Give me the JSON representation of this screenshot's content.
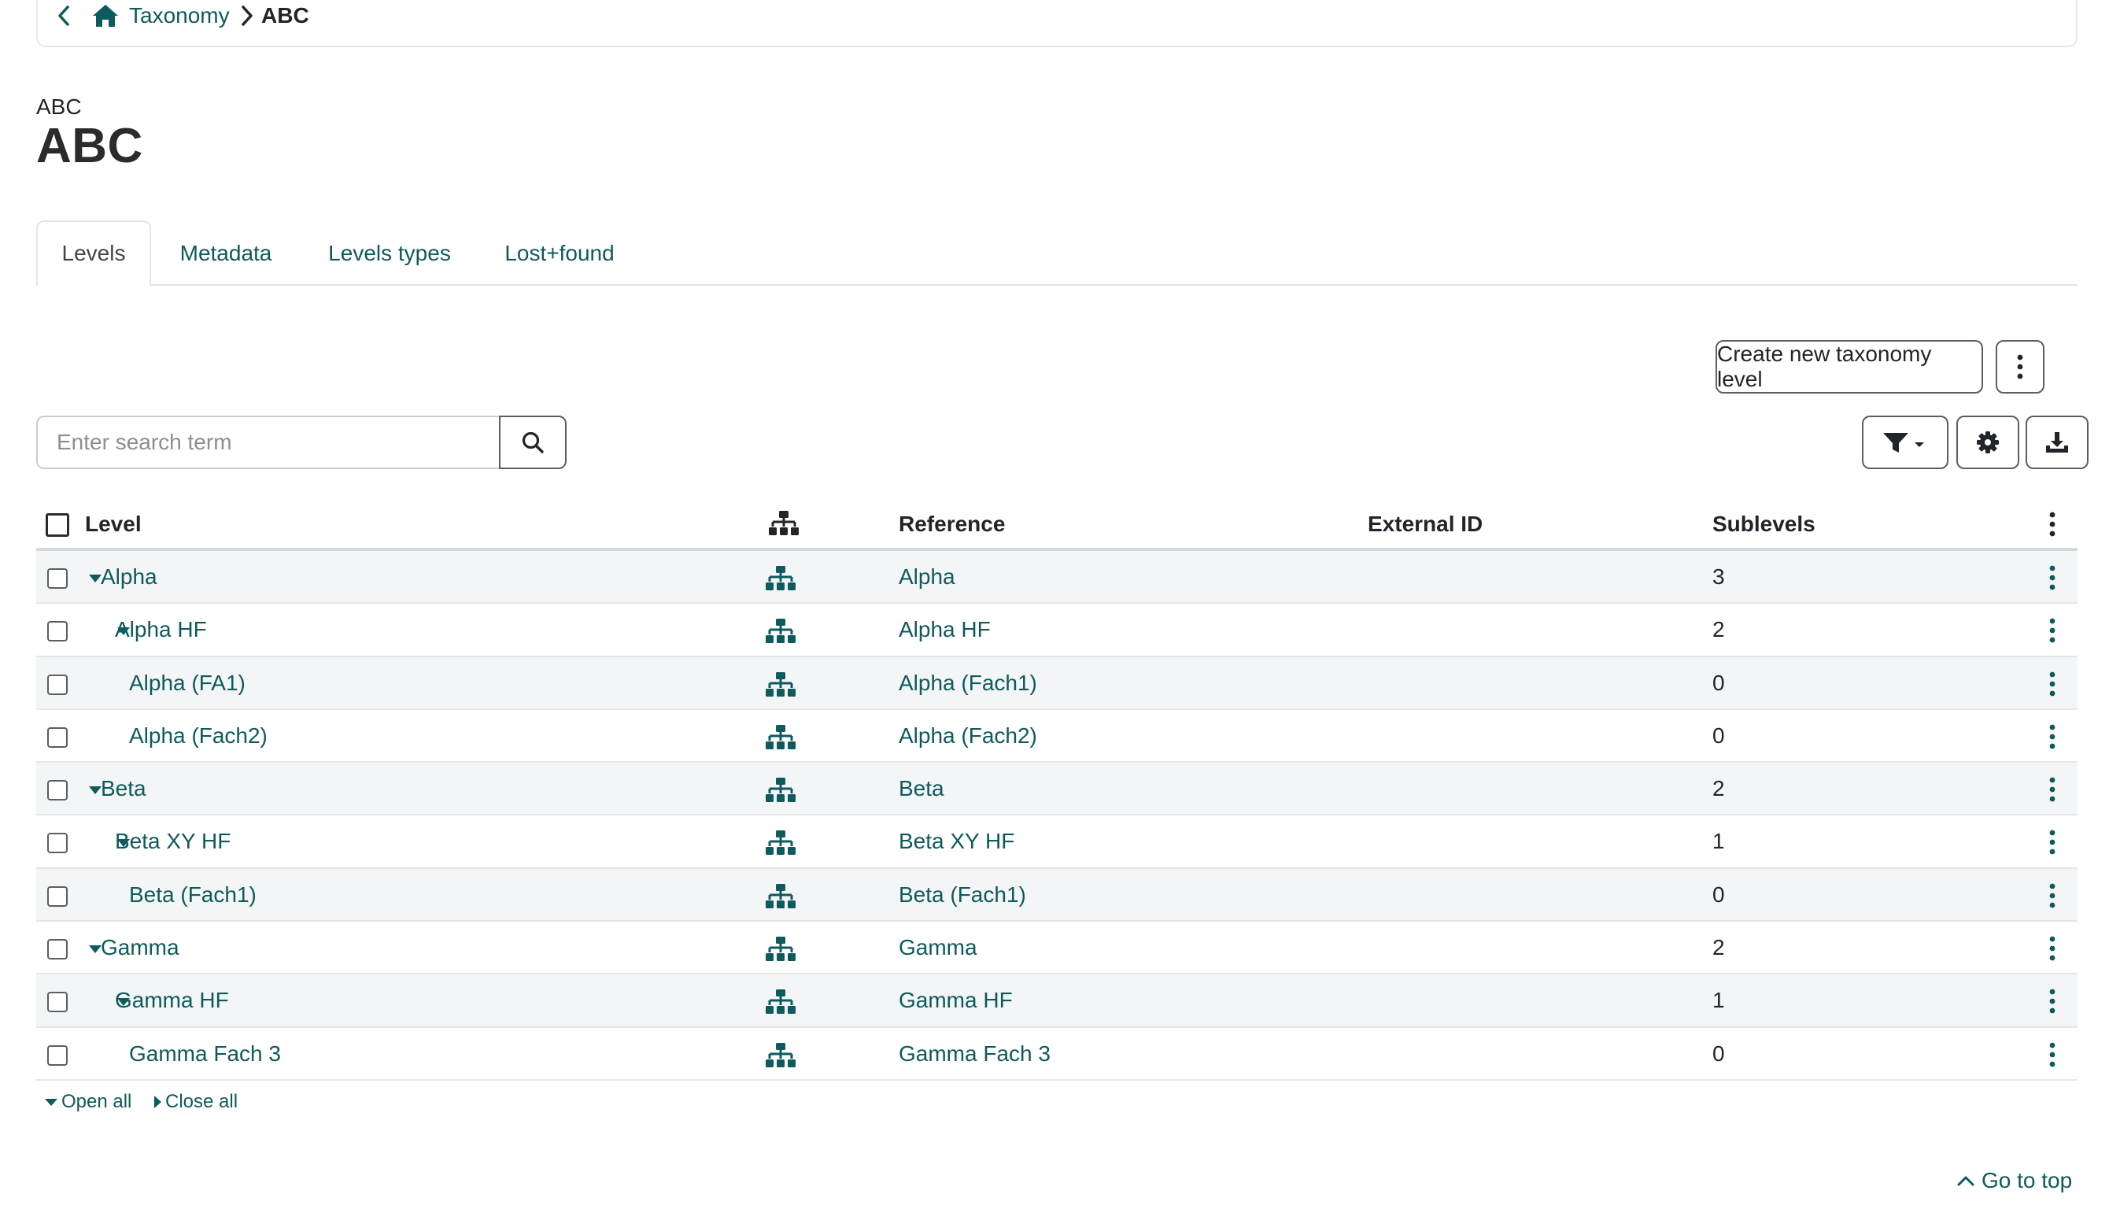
{
  "breadcrumb": {
    "back_icon": "chevron-left-icon",
    "home_icon": "home-icon",
    "parent": "Taxonomy",
    "separator_icon": "chevron-right-icon",
    "current": "ABC"
  },
  "header": {
    "subtitle": "ABC",
    "title": "ABC"
  },
  "tabs": [
    {
      "label": "Levels",
      "active": true
    },
    {
      "label": "Metadata",
      "active": false
    },
    {
      "label": "Levels types",
      "active": false
    },
    {
      "label": "Lost+found",
      "active": false
    }
  ],
  "toolbar": {
    "create_label": "Create new taxonomy level",
    "more_icon": "kebab-vertical-icon",
    "filter_icon": "filter-icon",
    "settings_icon": "gear-icon",
    "download_icon": "download-icon"
  },
  "search": {
    "placeholder": "Enter search term",
    "value": "",
    "button_icon": "search-icon"
  },
  "table": {
    "columns": {
      "level": "Level",
      "structure_icon": "hierarchy-icon",
      "reference": "Reference",
      "external_id": "External ID",
      "sublevels": "Sublevels"
    },
    "rows": [
      {
        "level": "Alpha",
        "depth": 0,
        "expanded": true,
        "reference": "Alpha",
        "external_id": "",
        "sublevels": "3"
      },
      {
        "level": "Alpha HF",
        "depth": 1,
        "expanded": true,
        "reference": "Alpha HF",
        "external_id": "",
        "sublevels": "2"
      },
      {
        "level": "Alpha (FA1)",
        "depth": 2,
        "expanded": false,
        "reference": "Alpha (Fach1)",
        "external_id": "",
        "sublevels": "0"
      },
      {
        "level": "Alpha (Fach2)",
        "depth": 2,
        "expanded": false,
        "reference": "Alpha (Fach2)",
        "external_id": "",
        "sublevels": "0"
      },
      {
        "level": "Beta",
        "depth": 0,
        "expanded": true,
        "reference": "Beta",
        "external_id": "",
        "sublevels": "2"
      },
      {
        "level": "Beta XY HF",
        "depth": 1,
        "expanded": true,
        "reference": "Beta XY HF",
        "external_id": "",
        "sublevels": "1"
      },
      {
        "level": "Beta (Fach1)",
        "depth": 2,
        "expanded": false,
        "reference": "Beta (Fach1)",
        "external_id": "",
        "sublevels": "0"
      },
      {
        "level": "Gamma",
        "depth": 0,
        "expanded": true,
        "reference": "Gamma",
        "external_id": "",
        "sublevels": "2"
      },
      {
        "level": "Gamma HF",
        "depth": 1,
        "expanded": true,
        "reference": "Gamma HF",
        "external_id": "",
        "sublevels": "1"
      },
      {
        "level": "Gamma Fach 3",
        "depth": 2,
        "expanded": false,
        "reference": "Gamma Fach 3",
        "external_id": "",
        "sublevels": "0"
      }
    ]
  },
  "tree_controls": {
    "open_all": "Open all",
    "close_all": "Close all"
  },
  "footer": {
    "go_to_top": "Go to top"
  },
  "colors": {
    "accent": "#0e5a5c",
    "text": "#212529",
    "row_stripe": "#f4f5f6"
  }
}
